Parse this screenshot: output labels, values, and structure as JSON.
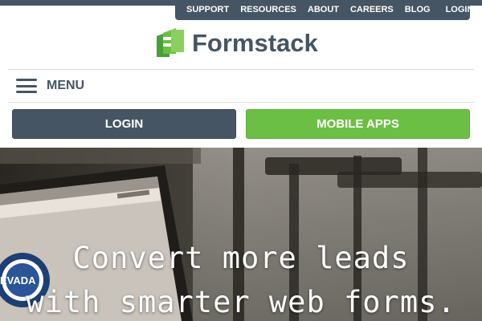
{
  "top_nav": {
    "items": [
      "SUPPORT",
      "RESOURCES",
      "ABOUT",
      "CAREERS",
      "BLOG"
    ],
    "login": "LOGIN"
  },
  "logo": {
    "text": "Formstack",
    "icon": "formstack-logo-icon"
  },
  "menu": {
    "label": "MENU",
    "icon": "hamburger-menu-icon"
  },
  "buttons": {
    "login": "LOGIN",
    "mobile_apps": "MOBILE APPS"
  },
  "hero": {
    "headline_line1": "Convert more leads",
    "headline_line2": "with smarter web forms."
  },
  "colors": {
    "nav_bg": "#465563",
    "brand_green": "#6cbf45",
    "text_dark": "#465563"
  }
}
